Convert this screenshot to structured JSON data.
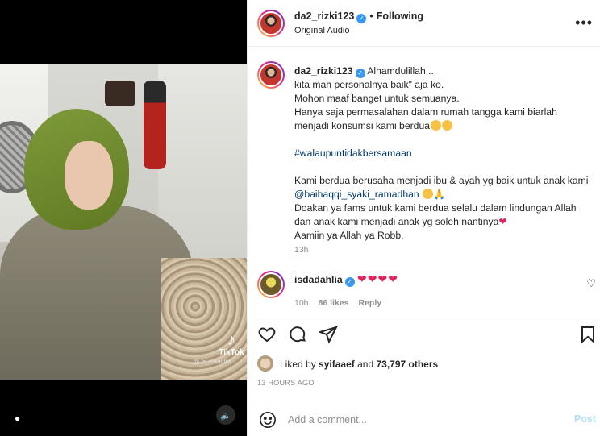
{
  "media": {
    "tiktok_label": "TikTok",
    "tiktok_user": "@ 2r_rizkindha"
  },
  "header": {
    "username": "da2_rizki123",
    "dot": "•",
    "following": "Following",
    "subtitle": "Original Audio",
    "more": "•••"
  },
  "caption": {
    "username": "da2_rizki123",
    "lines": [
      "Alhamdulillah...",
      "kita mah personalnya baik\" aja ko.",
      "Mohon maaf banget untuk semuanya.",
      "Hanya saja permasalahan dalam rumah tangga kami biarlah",
      "menjadi konsumsi kami berdua",
      "#walaupuntidakbersamaan",
      "Kami berdua berusaha menjadi ibu & ayah yg baik untuk anak kami",
      "@baihaqqi_syaki_ramadhan",
      "Doakan ya fams untuk kami berdua selalu dalam lindungan Allah",
      "dan anak kami menjadi anak yg soleh nantinya",
      "Aamiin ya Allah ya Robb."
    ],
    "time": "13h"
  },
  "comment": {
    "username": "isdadahlia",
    "text": "❤❤❤❤",
    "time": "10h",
    "likes": "86 likes",
    "reply": "Reply"
  },
  "likes": {
    "prefix": "Liked by",
    "user": "syifaaef",
    "conj": "and",
    "others": "73,797 others"
  },
  "posted": "13 HOURS AGO",
  "add_comment": {
    "placeholder": "Add a comment...",
    "post": "Post"
  },
  "colors": {
    "accent": "#3897f0",
    "link": "#00376b",
    "muted": "#8e8e8e",
    "heart": "#e0245e"
  }
}
